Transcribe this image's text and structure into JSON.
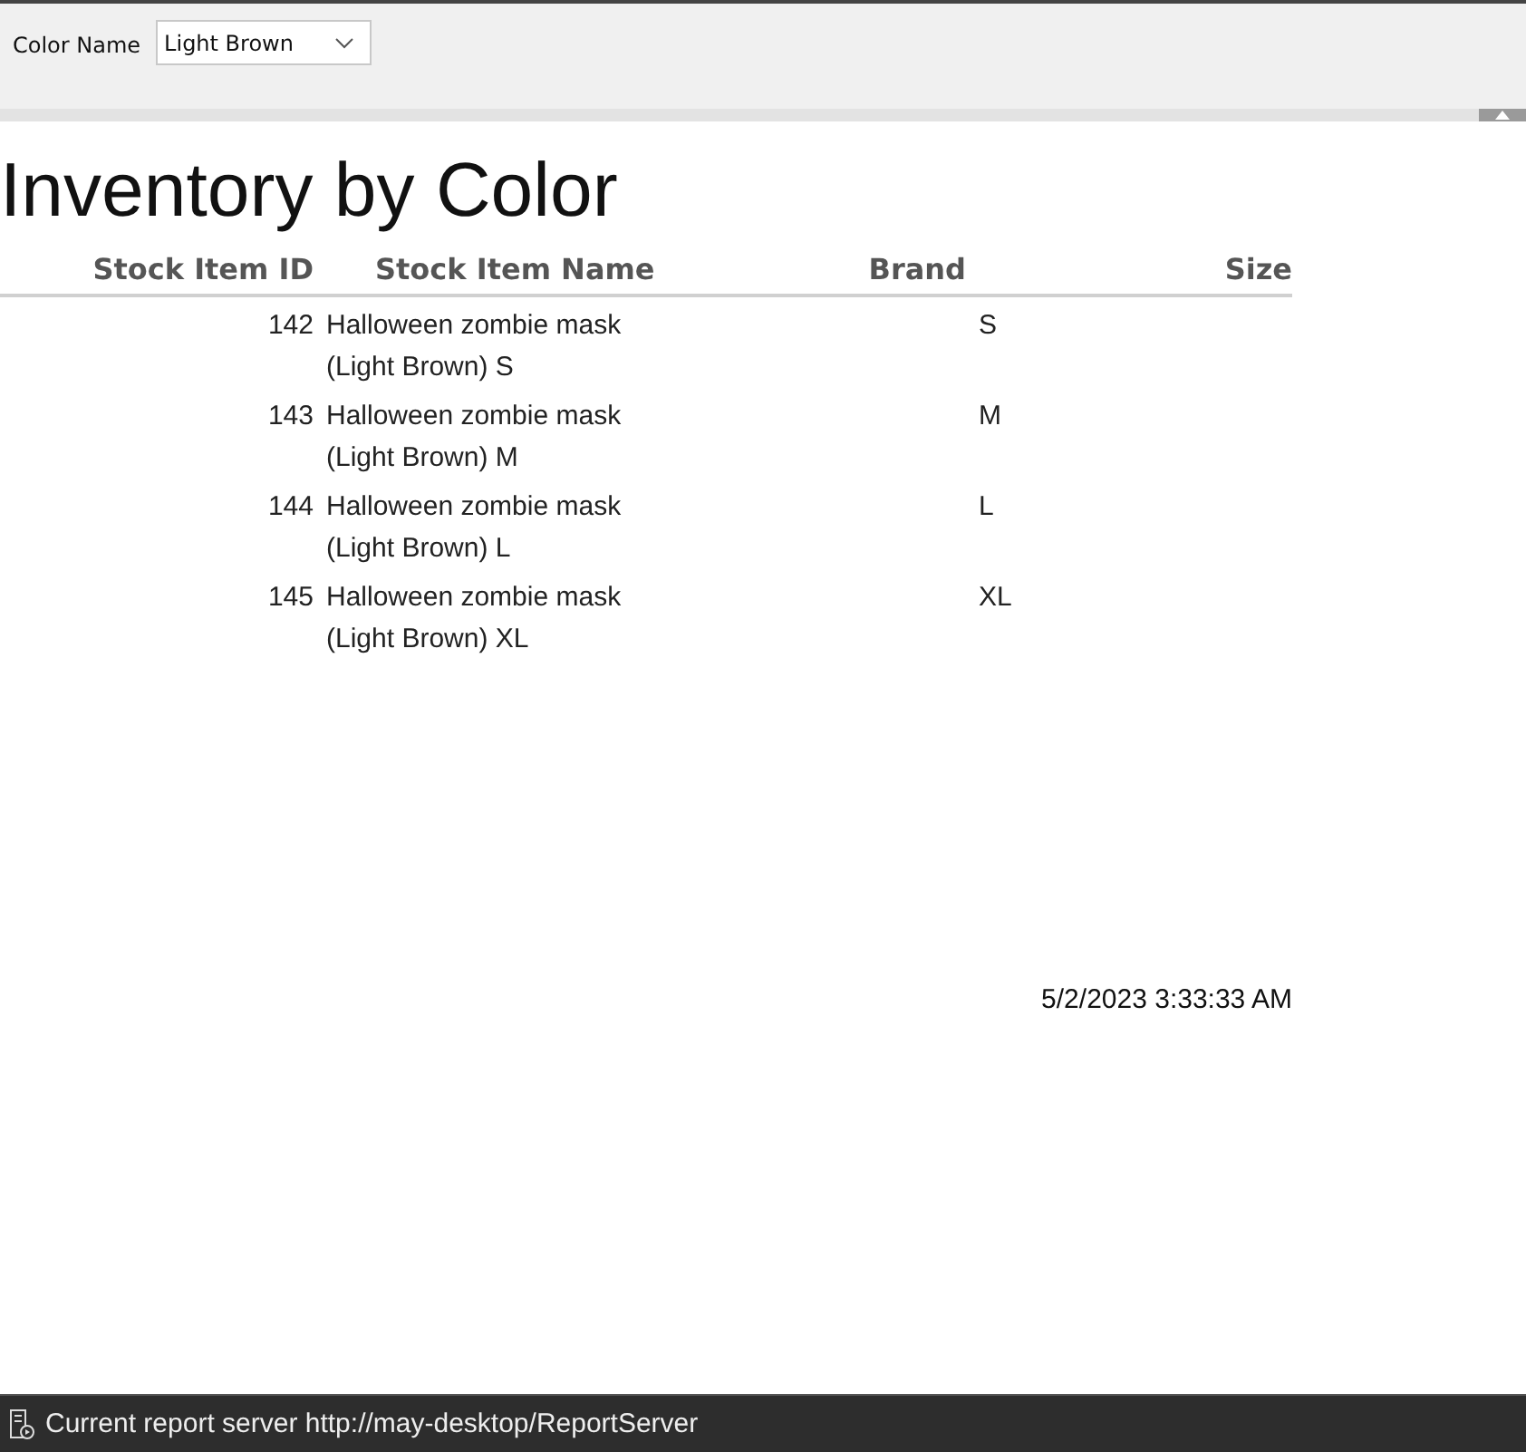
{
  "parameters": [
    {
      "label": "Color Name",
      "value": "Light Brown"
    }
  ],
  "report": {
    "title": "Inventory by Color",
    "columns": [
      "Stock Item ID",
      "Stock Item Name",
      "Brand",
      "Size"
    ],
    "rows": [
      {
        "id": "142",
        "name": "Halloween zombie mask (Light Brown) S",
        "size": "S"
      },
      {
        "id": "143",
        "name": "Halloween zombie mask (Light Brown) M",
        "size": "M"
      },
      {
        "id": "144",
        "name": "Halloween zombie mask (Light Brown) L",
        "size": "L"
      },
      {
        "id": "145",
        "name": "Halloween zombie mask (Light Brown) XL",
        "size": "XL"
      }
    ],
    "timestamp": "5/2/2023 3:33:33 AM"
  },
  "status_bar": {
    "text": "Current report server http://may-desktop/ReportServer"
  }
}
